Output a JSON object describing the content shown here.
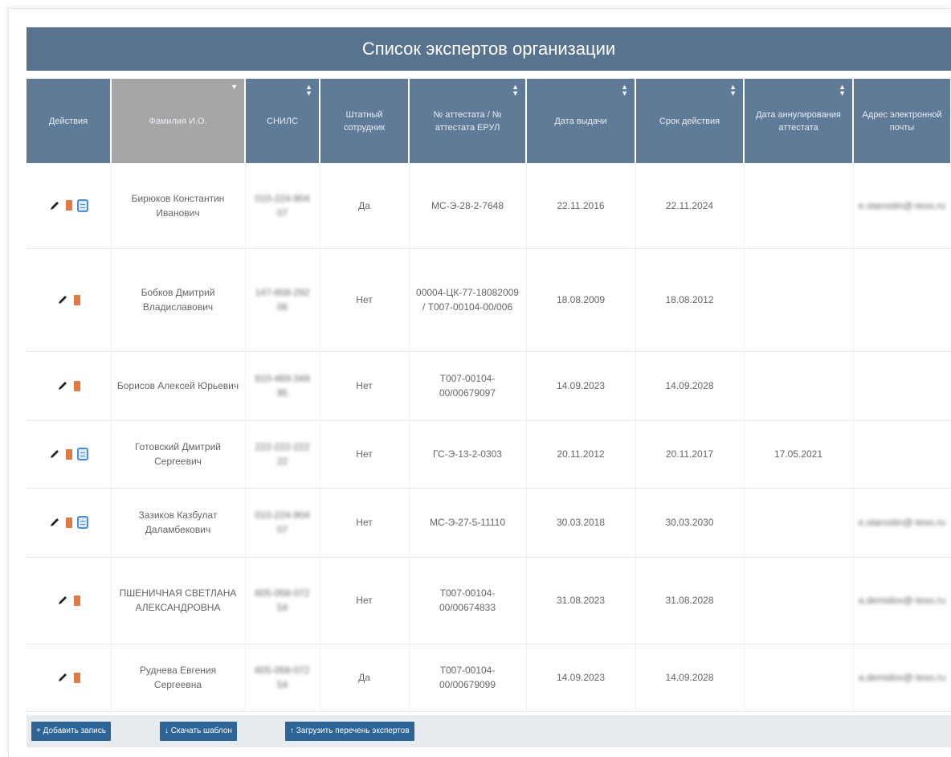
{
  "title": "Список экспертов организации",
  "columns": [
    "Действия",
    "Фамилия И.О.",
    "СНИЛС",
    "Штатный сотрудник",
    "№ аттестата / № аттестата ЕРУЛ",
    "Дата выдачи",
    "Срок действия",
    "Дата аннулирования аттестата",
    "Адрес электронной почты"
  ],
  "rows": [
    {
      "name": "Бирюков Константин Иванович",
      "snils": "010-224-904 07",
      "staff": "Да",
      "cert": "МС-Э-28-2-7648",
      "issued": "22.11.2016",
      "valid": "22.11.2024",
      "annulled": "",
      "email": "e.starostin@-tesо.ru",
      "doc": true
    },
    {
      "name": "Бобков Дмитрий Владиславович",
      "snils": "147-658-292 06",
      "staff": "Нет",
      "cert": "00004-ЦК-77-18082009 / Т007-00104-00/006",
      "issued": "18.08.2009",
      "valid": "18.08.2012",
      "annulled": "",
      "email": "",
      "doc": false
    },
    {
      "name": "Борисов Алексей Юрьевич",
      "snils": "810-469-349 95",
      "staff": "Нет",
      "cert": "Т007-00104-00/00679097",
      "issued": "14.09.2023",
      "valid": "14.09.2028",
      "annulled": "",
      "email": "",
      "doc": false
    },
    {
      "name": "Готовский Дмитрий Сергеевич",
      "snils": "222-222-222 22",
      "staff": "Нет",
      "cert": "ГС-Э-13-2-0303",
      "issued": "20.11.2012",
      "valid": "20.11.2017",
      "annulled": "17.05.2021",
      "email": "",
      "doc": true
    },
    {
      "name": "Зазиков Казбулат Даламбекович",
      "snils": "010-224-904 07",
      "staff": "Нет",
      "cert": "МС-Э-27-5-11110",
      "issued": "30.03.2018",
      "valid": "30.03.2030",
      "annulled": "",
      "email": "e.starostin@-tesо.ru",
      "doc": true
    },
    {
      "name": "ПШЕНИЧНАЯ СВЕТЛАНА АЛЕКСАНДРОВНА",
      "snils": "605-058-072 54",
      "staff": "Нет",
      "cert": "Т007-00104-00/00674833",
      "issued": "31.08.2023",
      "valid": "31.08.2028",
      "annulled": "",
      "email": "a.demidov@-tesо.ru",
      "doc": false
    },
    {
      "name": "Руднева Евгения Сергеевна",
      "snils": "605-058-072 54",
      "staff": "Да",
      "cert": "Т007-00104-00/00679099",
      "issued": "14.09.2023",
      "valid": "14.09.2028",
      "annulled": "",
      "email": "a.demidov@-tesо.ru",
      "doc": false
    }
  ],
  "buttons": {
    "add": "+ Добавить запись",
    "download": "↓ Скачать шаблон",
    "upload": "↑ Загрузить перечень экспертов"
  },
  "colors": {
    "header": "#5f7b97",
    "title": "#58728f",
    "button": "#2e6596",
    "annulled": "#e0443e"
  }
}
